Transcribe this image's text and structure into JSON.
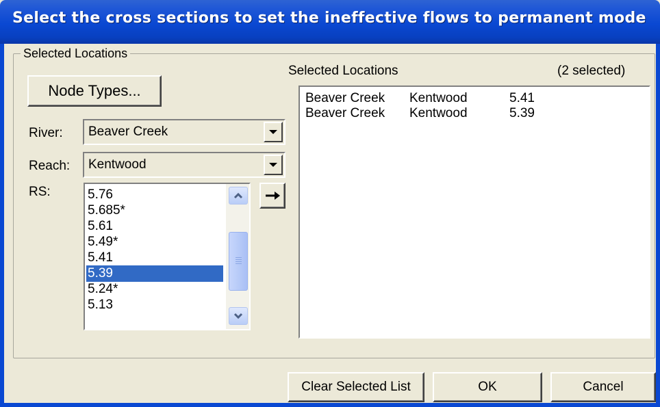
{
  "window": {
    "title": "Select the cross sections to set the ineffective flows to permanent mode"
  },
  "group": {
    "legend": "Selected Locations"
  },
  "node_types_button": "Node Types...",
  "river": {
    "label": "River:",
    "value": "Beaver Creek"
  },
  "reach": {
    "label": "Reach:",
    "value": "Kentwood"
  },
  "rs": {
    "label": "RS:",
    "items": [
      "5.76",
      "5.685*",
      "5.61",
      "5.49*",
      "5.41",
      "5.39",
      "5.24*",
      "5.13"
    ],
    "selected": "5.39"
  },
  "selected_locations": {
    "header": "Selected Locations",
    "count": "(2 selected)",
    "rows": [
      {
        "river": "Beaver Creek",
        "reach": "Kentwood",
        "rs": "5.41"
      },
      {
        "river": "Beaver Creek",
        "reach": "Kentwood",
        "rs": "5.39"
      }
    ]
  },
  "buttons": {
    "clear": "Clear Selected List",
    "ok": "OK",
    "cancel": "Cancel"
  },
  "icons": {
    "add": "right-arrow-icon",
    "dropdown": "chevron-down-icon",
    "scroll_up": "scroll-up-icon",
    "scroll_down": "scroll-down-icon"
  }
}
